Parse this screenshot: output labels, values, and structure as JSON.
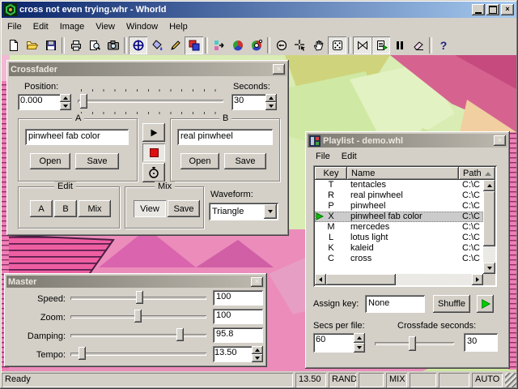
{
  "window": {
    "title": "cross not even trying.whr - Whorld"
  },
  "menu": {
    "items": [
      "File",
      "Edit",
      "Image",
      "View",
      "Window",
      "Help"
    ]
  },
  "toolbar": {
    "buttons": [
      "new",
      "open",
      "save",
      "print",
      "print-preview",
      "snapshot",
      "pan",
      "fill",
      "draw",
      "colors",
      "random-phase",
      "color-wheel",
      "color-rings",
      "origin",
      "crosshair",
      "hand",
      "random",
      "crossfader",
      "playlist",
      "pause",
      "erase",
      "help"
    ],
    "toggled": [
      "pan",
      "colors",
      "random",
      "crossfader",
      "playlist"
    ]
  },
  "crossfader": {
    "title": "Crossfader",
    "position_label": "Position:",
    "position_value": "0.000",
    "seconds_label": "Seconds:",
    "seconds_value": "30",
    "a": {
      "label": "A",
      "value": "pinwheel fab color",
      "open": "Open",
      "save": "Save"
    },
    "b": {
      "label": "B",
      "value": "real pinwheel",
      "open": "Open",
      "save": "Save"
    },
    "edit": {
      "label": "Edit",
      "a": "A",
      "b": "B",
      "mix": "Mix"
    },
    "mix": {
      "label": "Mix",
      "view": "View",
      "save": "Save"
    },
    "waveform": {
      "label": "Waveform:",
      "value": "Triangle"
    }
  },
  "playlist": {
    "title": "Playlist - demo.whl",
    "menu": [
      "File",
      "Edit"
    ],
    "columns": [
      "Key",
      "Name",
      "Path"
    ],
    "rows": [
      {
        "key": "T",
        "name": "tentacles",
        "path": "C:\\C"
      },
      {
        "key": "R",
        "name": "real pinwheel",
        "path": "C:\\C"
      },
      {
        "key": "P",
        "name": "pinwheel",
        "path": "C:\\C"
      },
      {
        "key": "X",
        "name": "pinwheel fab color",
        "path": "C:\\C"
      },
      {
        "key": "M",
        "name": "mercedes",
        "path": "C:\\C"
      },
      {
        "key": "L",
        "name": "lotus light",
        "path": "C:\\C"
      },
      {
        "key": "K",
        "name": "kaleid",
        "path": "C:\\C"
      },
      {
        "key": "C",
        "name": "cross",
        "path": "C:\\C"
      }
    ],
    "selected_row": 3,
    "assign_key_label": "Assign key:",
    "assign_key_value": "None",
    "shuffle_label": "Shuffle",
    "secs_per_file_label": "Secs per file:",
    "secs_per_file_value": "60",
    "crossfade_label": "Crossfade seconds:",
    "crossfade_value": "30"
  },
  "master": {
    "title": "Master",
    "rows": [
      {
        "label": "Speed:",
        "value": "100"
      },
      {
        "label": "Zoom:",
        "value": "100"
      },
      {
        "label": "Damping:",
        "value": "95.8"
      },
      {
        "label": "Tempo:",
        "value": "13.50"
      }
    ]
  },
  "statusbar": {
    "message": "Ready",
    "panes": [
      "13.50",
      "RAND",
      "",
      "MIX",
      "",
      "",
      "AUTO"
    ]
  },
  "colors": {
    "chrome": "#d4d0c8",
    "titlebar_active": [
      "#0a246a",
      "#a6caf0"
    ],
    "titlebar_inactive": [
      "#7d7a72",
      "#bdb9af"
    ],
    "record_red": "#dd1111",
    "play_green": "#00c000",
    "canvas_pink": "#eb8cba",
    "canvas_green": "#d8ecb4"
  }
}
